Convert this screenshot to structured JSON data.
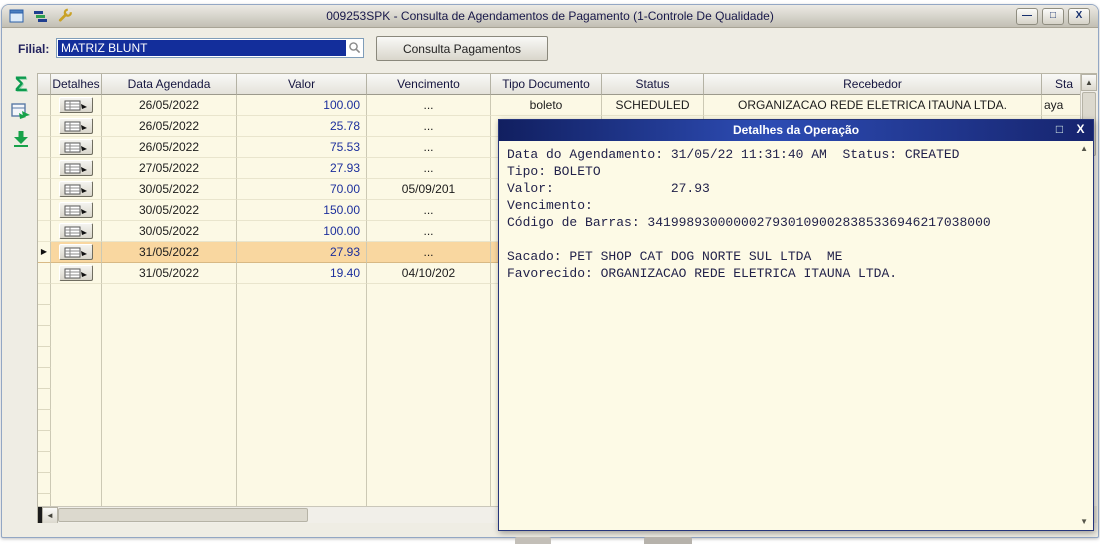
{
  "colors": {
    "accent_navy": "#132e9b",
    "popup_title_navy": "#2d4cb4",
    "selection_orange": "#f9d7a0",
    "grid_cream": "#fcf9e5",
    "icon_green": "#18a24a",
    "wrench_gold": "#c9a227"
  },
  "window": {
    "title": "009253SPK - Consulta de Agendamentos de Pagamento (1-Controle De Qualidade)",
    "controls": {
      "minimize": "—",
      "maximize": "□",
      "close": "X"
    }
  },
  "toolbar": {
    "filial_label": "Filial:",
    "filial_value": "MATRIZ BLUNT",
    "consulta_button": "Consulta Pagamentos"
  },
  "side": {
    "sigma": "Σ"
  },
  "grid": {
    "headers": [
      "Detalhes",
      "Data Agendada",
      "Valor",
      "Vencimento",
      "Tipo Documento",
      "Status",
      "Recebedor",
      "Sta"
    ],
    "empty_row_count": 11,
    "rows": [
      {
        "data_agendada": "26/05/2022",
        "valor": "100.00",
        "vencimento": "...",
        "tipo_documento": "boleto",
        "status": "SCHEDULED",
        "recebedor": "ORGANIZACAO REDE ELETRICA ITAUNA LTDA.",
        "sta": "aya",
        "selected": false
      },
      {
        "data_agendada": "26/05/2022",
        "valor": "25.78",
        "vencimento": "...",
        "tipo_documento": "",
        "status": "",
        "recebedor": "",
        "sta": "",
        "selected": false
      },
      {
        "data_agendada": "26/05/2022",
        "valor": "75.53",
        "vencimento": "...",
        "tipo_documento": "",
        "status": "",
        "recebedor": "",
        "sta": "",
        "selected": false
      },
      {
        "data_agendada": "27/05/2022",
        "valor": "27.93",
        "vencimento": "...",
        "tipo_documento": "",
        "status": "",
        "recebedor": "",
        "sta": "",
        "selected": false
      },
      {
        "data_agendada": "30/05/2022",
        "valor": "70.00",
        "vencimento": "05/09/201",
        "tipo_documento": "",
        "status": "",
        "recebedor": "",
        "sta": "",
        "selected": false
      },
      {
        "data_agendada": "30/05/2022",
        "valor": "150.00",
        "vencimento": "...",
        "tipo_documento": "",
        "status": "",
        "recebedor": "",
        "sta": "",
        "selected": false
      },
      {
        "data_agendada": "30/05/2022",
        "valor": "100.00",
        "vencimento": "...",
        "tipo_documento": "",
        "status": "",
        "recebedor": "",
        "sta": "",
        "selected": false
      },
      {
        "data_agendada": "31/05/2022",
        "valor": "27.93",
        "vencimento": "...",
        "tipo_documento": "",
        "status": "",
        "recebedor": "",
        "sta": "",
        "selected": true
      },
      {
        "data_agendada": "31/05/2022",
        "valor": "19.40",
        "vencimento": "04/10/202",
        "tipo_documento": "",
        "status": "",
        "recebedor": "",
        "sta": "",
        "selected": false
      }
    ]
  },
  "popup": {
    "title": "Detalhes da Operação",
    "controls": {
      "maximize": "□",
      "close": "X"
    },
    "lines": [
      "Data do Agendamento: 31/05/22 11:31:40 AM  Status: CREATED",
      "Tipo: BOLETO",
      "Valor:               27.93",
      "Vencimento:",
      "Código de Barras: 34199893000000279301090028385336946217038000",
      "",
      "Sacado: PET SHOP CAT DOG NORTE SUL LTDA  ME",
      "Favorecido: ORGANIZACAO REDE ELETRICA ITAUNA LTDA."
    ]
  },
  "icons": {
    "scroll_up": "▲",
    "scroll_down": "▼",
    "scroll_left": "◄",
    "row_marker": "▶"
  }
}
